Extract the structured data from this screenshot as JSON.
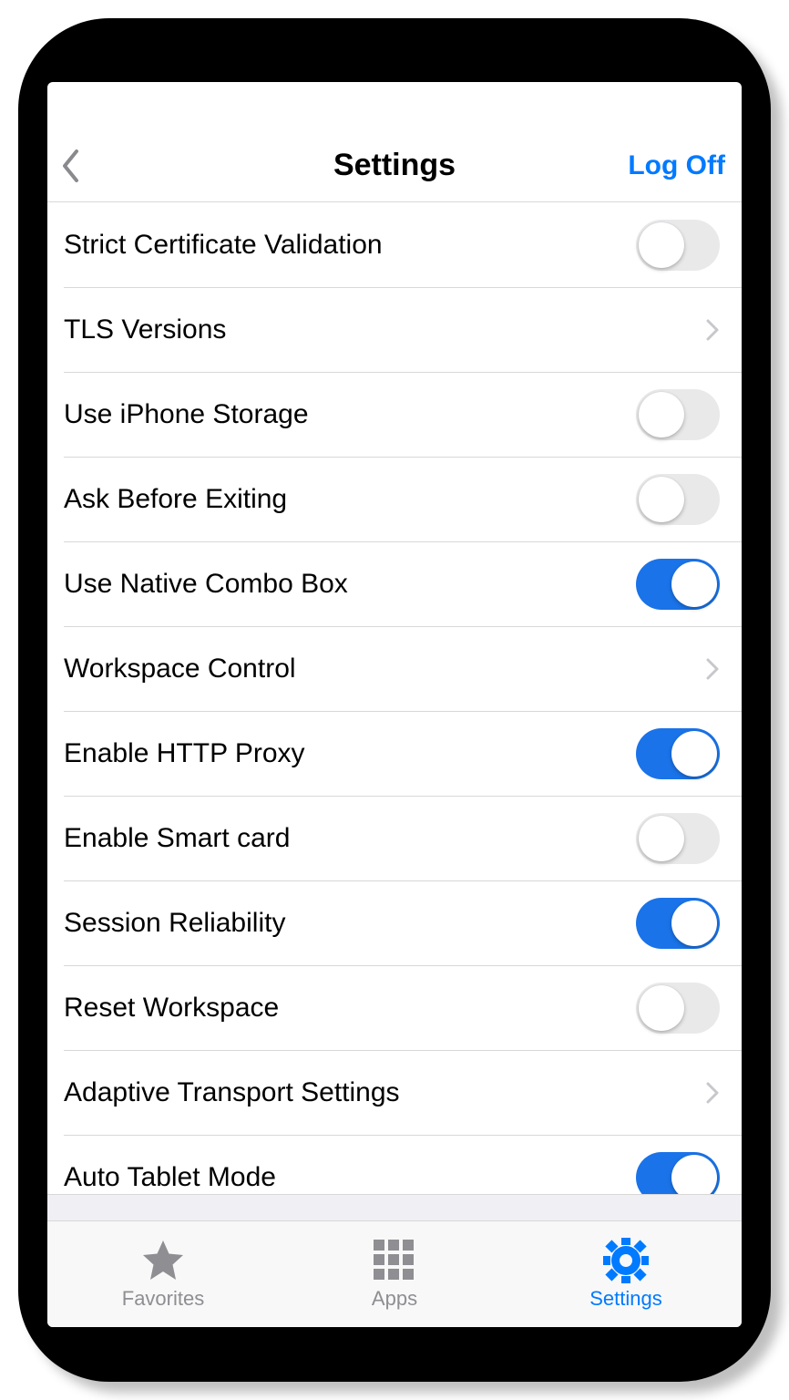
{
  "colors": {
    "accent": "#007aff",
    "switch_on": "#1a73e8",
    "inactive": "#8e8e93"
  },
  "navbar": {
    "title": "Settings",
    "logoff_label": "Log Off"
  },
  "settings": [
    {
      "key": "strict-cert",
      "label": "Strict Certificate Validation",
      "type": "switch",
      "value": false
    },
    {
      "key": "tls-versions",
      "label": "TLS Versions",
      "type": "disclosure"
    },
    {
      "key": "iphone-storage",
      "label": "Use iPhone Storage",
      "type": "switch",
      "value": false
    },
    {
      "key": "ask-exit",
      "label": "Ask Before Exiting",
      "type": "switch",
      "value": false
    },
    {
      "key": "native-combo",
      "label": "Use Native Combo Box",
      "type": "switch",
      "value": true
    },
    {
      "key": "workspace-ctl",
      "label": "Workspace Control",
      "type": "disclosure"
    },
    {
      "key": "http-proxy",
      "label": "Enable HTTP Proxy",
      "type": "switch",
      "value": true
    },
    {
      "key": "smartcard",
      "label": "Enable Smart card",
      "type": "switch",
      "value": false
    },
    {
      "key": "session-rel",
      "label": "Session Reliability",
      "type": "switch",
      "value": true
    },
    {
      "key": "reset-ws",
      "label": "Reset Workspace",
      "type": "switch",
      "value": false
    },
    {
      "key": "adaptive-trans",
      "label": "Adaptive Transport Settings",
      "type": "disclosure"
    },
    {
      "key": "auto-tablet",
      "label": "Auto Tablet Mode",
      "type": "switch",
      "value": true
    }
  ],
  "tabs": [
    {
      "key": "favorites",
      "label": "Favorites",
      "icon": "star-icon",
      "active": false
    },
    {
      "key": "apps",
      "label": "Apps",
      "icon": "grid-icon",
      "active": false
    },
    {
      "key": "settings",
      "label": "Settings",
      "icon": "gear-icon",
      "active": true
    }
  ]
}
